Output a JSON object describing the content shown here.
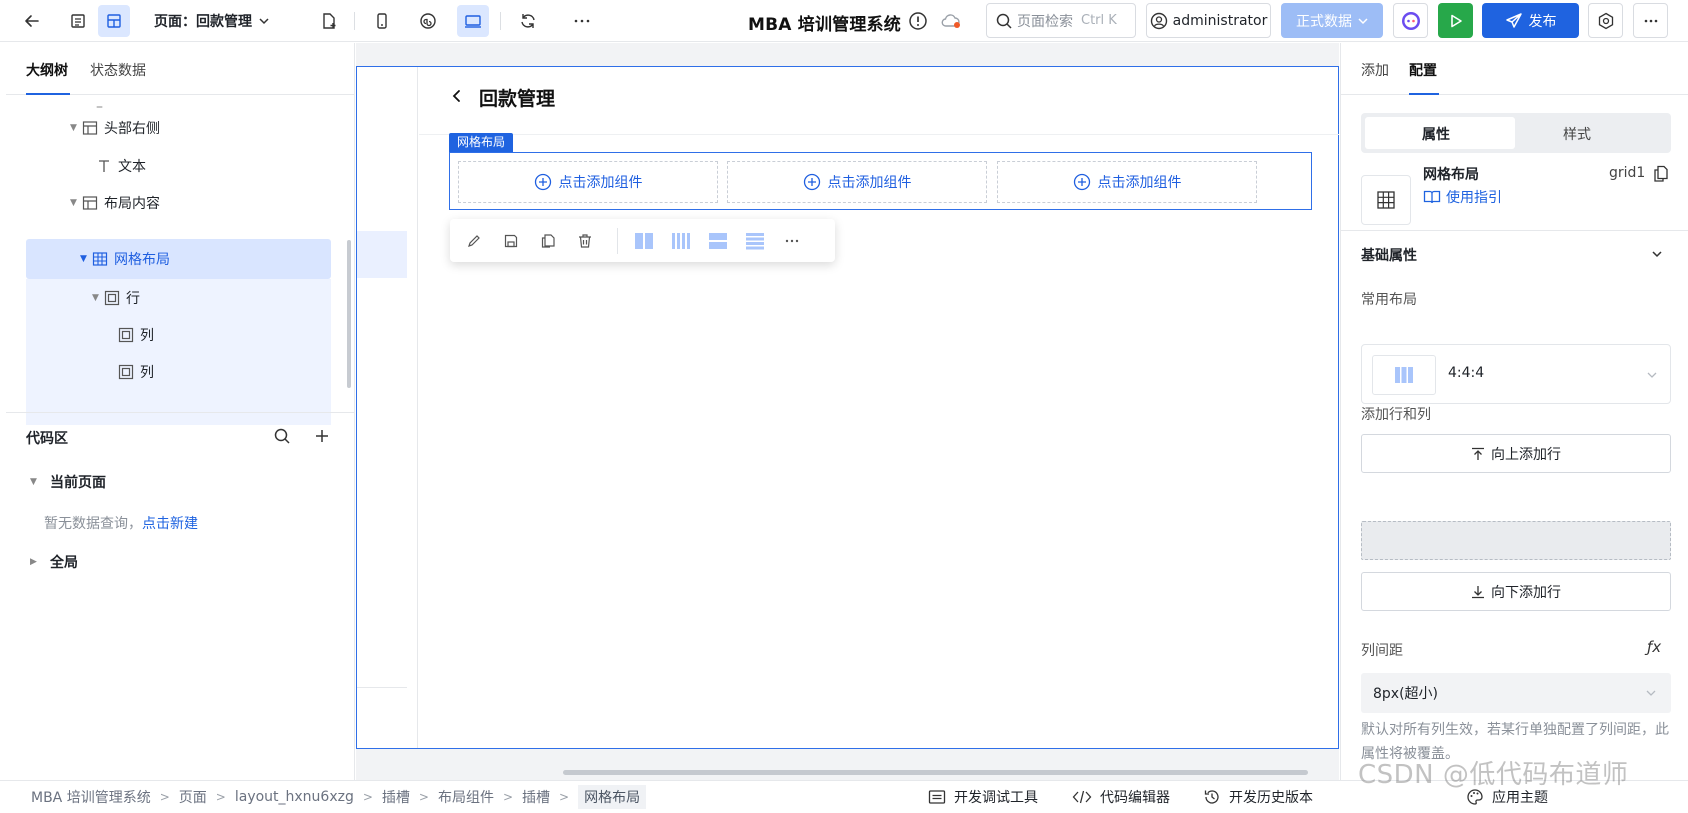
{
  "topbar": {
    "page_label": "页面：回款管理",
    "app_title": "MBA 培训管理系统",
    "search_placeholder": "页面检索",
    "search_shortcut": "Ctrl K",
    "user": "administrator",
    "env": "正式数据",
    "publish": "发布"
  },
  "left_panel": {
    "tabs": [
      "大纲树",
      "状态数据"
    ],
    "active_tab": "大纲树",
    "tree": [
      {
        "label": "–",
        "icon": "dash"
      },
      {
        "label": "头部右侧",
        "icon": "layout-icon"
      },
      {
        "label": "文本",
        "icon": "text-icon"
      },
      {
        "label": "布局内容",
        "icon": "layout-icon"
      },
      {
        "label": "网格布局",
        "icon": "grid-icon",
        "selected": true
      },
      {
        "label": "行",
        "icon": "row-icon"
      },
      {
        "label": "列",
        "icon": "col-icon"
      },
      {
        "label": "列",
        "icon": "col-icon"
      }
    ],
    "code_area": {
      "title": "代码区",
      "current_page": "当前页面",
      "empty_text": "暂无数据查询，",
      "create_link": "点击新建",
      "global": "全局"
    }
  },
  "canvas": {
    "page_title": "回款管理",
    "grid_tag": "网格布局",
    "columns": [
      {
        "label": "点击添加组件"
      },
      {
        "label": "点击添加组件"
      },
      {
        "label": "点击添加组件"
      }
    ]
  },
  "right_panel": {
    "tabs": [
      "添加",
      "配置"
    ],
    "active_tab": "配置",
    "segments": [
      "属性",
      "样式"
    ],
    "active_segment": "属性",
    "component_name": "网格布局",
    "component_id": "grid1",
    "guide_link": "使用指引",
    "section_basic": "基础属性",
    "common_layout_label": "常用布局",
    "common_layout_value": "4:4:4",
    "add_rows_label": "添加行和列",
    "add_row_above": "向上添加行",
    "add_row_below": "向下添加行",
    "col_gap_label": "列间距",
    "col_gap_value": "8px(超小)",
    "col_gap_help": "默认对所有列生效，若某行单独配置了列间距，此属性将被覆盖。"
  },
  "footer": {
    "breadcrumb": [
      "MBA 培训管理系统",
      "页面",
      "layout_hxnu6xzg",
      "插槽",
      "布局组件",
      "插槽",
      "网格布局"
    ],
    "dev_tools": "开发调试工具",
    "code_editor": "代码编辑器",
    "history": "开发历史版本",
    "theme": "应用主题"
  },
  "watermark": "CSDN @低代码布道师",
  "colors": {
    "accent": "#1f63e0",
    "run": "#27a84a",
    "env_button": "#9dbdf6",
    "selection": "#d9e5ff"
  }
}
